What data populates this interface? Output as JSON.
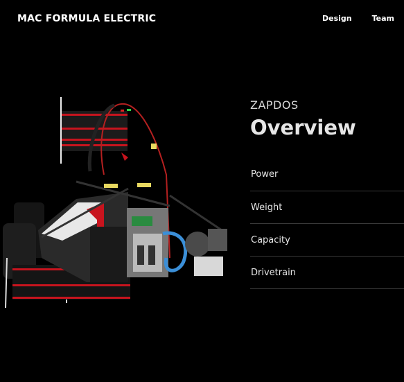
{
  "header": {
    "brand": "MAC FORMULA ELECTRIC",
    "nav": [
      {
        "label": "Design"
      },
      {
        "label": "Team"
      }
    ]
  },
  "hero": {
    "car_name": "ZAPDOS",
    "section_title": "Overview",
    "specs": [
      {
        "label": "Power"
      },
      {
        "label": "Weight"
      },
      {
        "label": "Capacity"
      },
      {
        "label": "Drivetrain"
      }
    ]
  },
  "colors": {
    "background": "#000000",
    "accent_red": "#c8141e",
    "divider": "#3a3a3a"
  }
}
